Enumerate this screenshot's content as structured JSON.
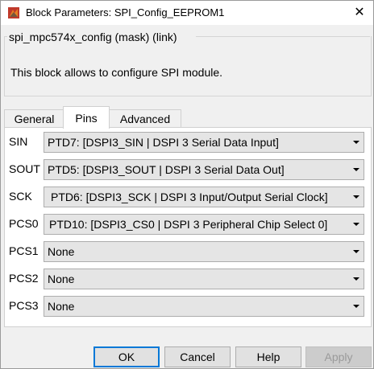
{
  "window": {
    "title": "Block Parameters: SPI_Config_EEPROM1",
    "close_glyph": "✕"
  },
  "mask": {
    "legend": "spi_mpc574x_config (mask) (link)",
    "description": "This block allows to configure SPI module."
  },
  "tabs": [
    {
      "label": "General",
      "active": false
    },
    {
      "label": "Pins",
      "active": true
    },
    {
      "label": "Advanced",
      "active": false
    }
  ],
  "pins": [
    {
      "label": "SIN",
      "value": "PTD7: [DSPI3_SIN | DSPI 3 Serial Data Input]"
    },
    {
      "label": "SOUT",
      "value": "PTD5: [DSPI3_SOUT | DSPI 3 Serial Data Out]"
    },
    {
      "label": "SCK",
      "value": "PTD6: [DSPI3_SCK | DSPI 3 Input/Output Serial Clock]"
    },
    {
      "label": "PCS0",
      "value": "PTD10: [DSPI3_CS0 | DSPI 3 Peripheral Chip Select 0]"
    },
    {
      "label": "PCS1",
      "value": "None"
    },
    {
      "label": "PCS2",
      "value": "None"
    },
    {
      "label": "PCS3",
      "value": "None"
    }
  ],
  "buttons": {
    "ok": "OK",
    "cancel": "Cancel",
    "help": "Help",
    "apply": "Apply"
  },
  "colors": {
    "accent": "#0078d7",
    "dropdown_bg": "#e5e5e5",
    "panel_bg": "#ffffff"
  },
  "icons": {
    "app": "simulink-block-icon",
    "close": "close-icon",
    "dropdown": "chevron-down-icon"
  }
}
